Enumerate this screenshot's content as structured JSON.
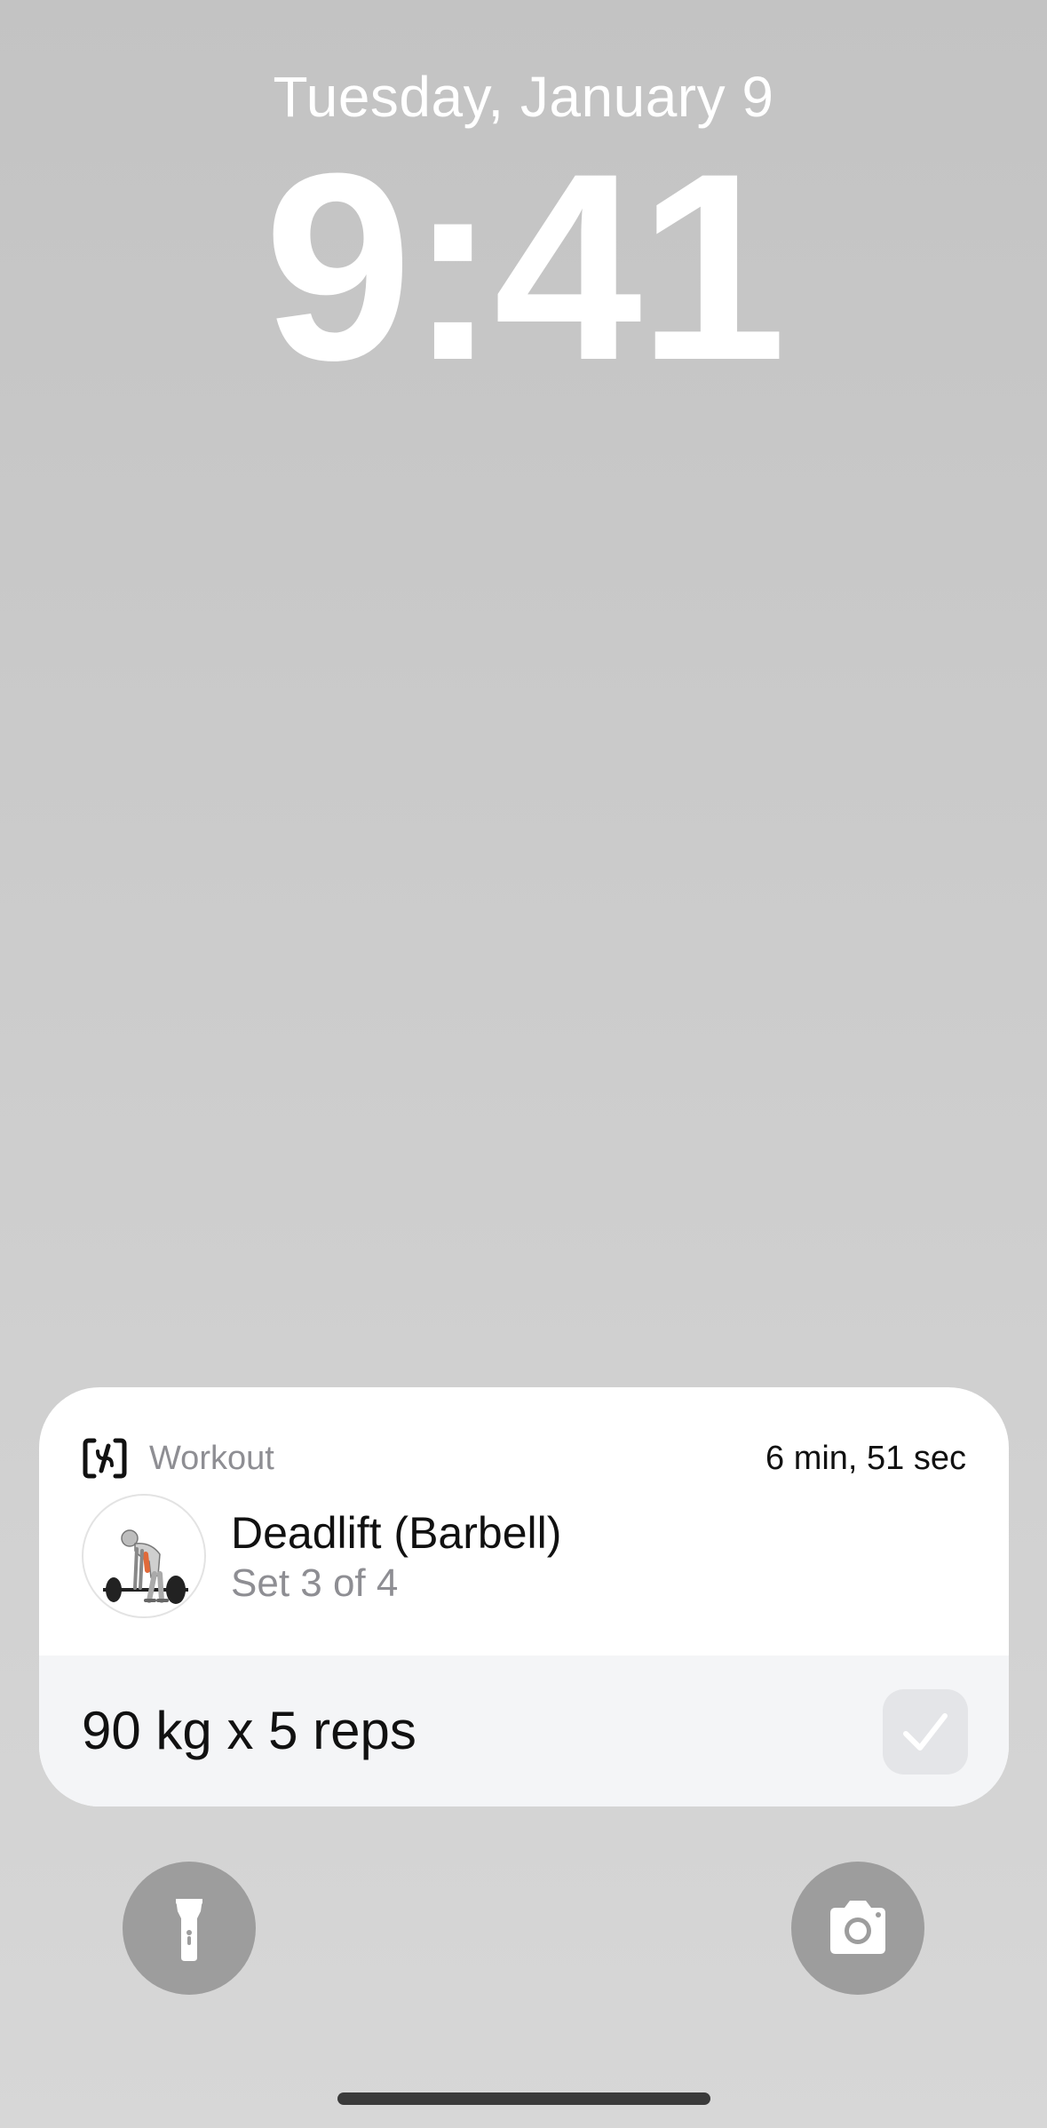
{
  "lock_screen": {
    "date": "Tuesday, January 9",
    "time": "9:41"
  },
  "live_activity": {
    "app_icon": "hevy-app-icon",
    "app_name": "Workout",
    "elapsed": "6 min, 51 sec",
    "exercise": {
      "name": "Deadlift (Barbell)",
      "set_progress": "Set 3 of 4",
      "image": "deadlift-illustration"
    },
    "current_set": "90 kg x 5 reps",
    "complete_icon": "checkmark-icon"
  },
  "quick_actions": {
    "left": "flashlight-icon",
    "right": "camera-icon"
  },
  "colors": {
    "widget_bg": "#ffffff",
    "set_row_bg": "#f4f5f7",
    "secondary_text": "#8e8e93",
    "button_bg": "#9d9d9d"
  }
}
